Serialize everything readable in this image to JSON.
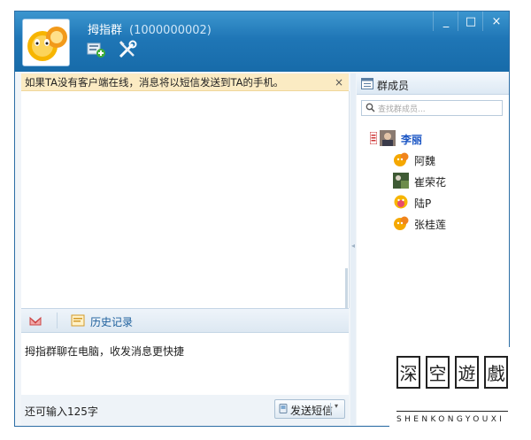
{
  "window": {
    "title": "拇指群",
    "title_id": "(1000000002)",
    "controls": [
      "_",
      "□",
      "×"
    ]
  },
  "notice": {
    "text": "如果TA没有客户端在线，消息将以短信发送到TA的手机。",
    "close": "×"
  },
  "toolbar": {
    "history_label": "历史记录"
  },
  "input": {
    "text": "拇指群聊在电脑，收发消息更快捷"
  },
  "footer": {
    "char_count": "还可输入125字",
    "send_label": "发送短信",
    "send_arrow": "▾"
  },
  "members": {
    "title": "群成员",
    "search_placeholder": "查找群成员...",
    "items": [
      {
        "name": "李丽"
      },
      {
        "name": "阿魏"
      },
      {
        "name": "崔荣花"
      },
      {
        "name": "陆P"
      },
      {
        "name": "张桂莲"
      }
    ]
  },
  "watermark": {
    "chars": [
      "深",
      "空",
      "遊",
      "戲"
    ],
    "subtitle": "SHENKONGYOUXI"
  },
  "colors": {
    "titlebar": "#1f76b6",
    "notice_bg": "#fbebc3",
    "self_name": "#1a55c4"
  }
}
